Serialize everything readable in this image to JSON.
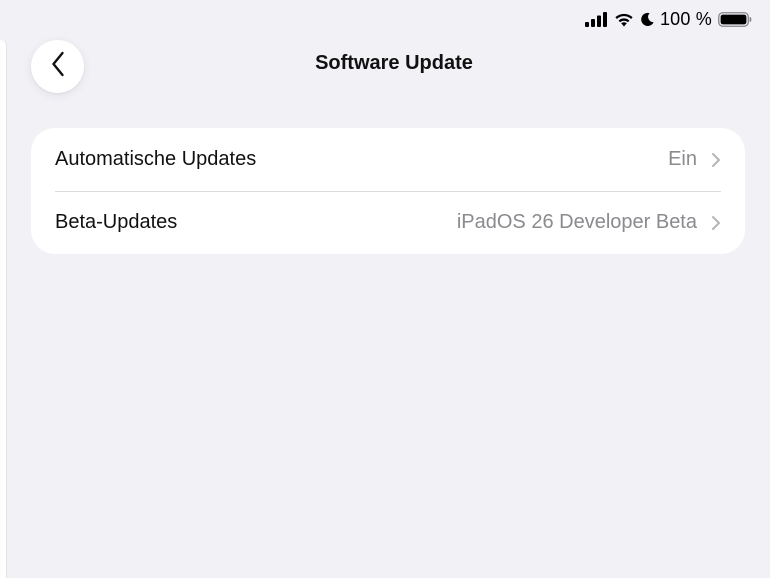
{
  "status_bar": {
    "battery_percent": "100 %",
    "icons": [
      "cellular-signal-icon",
      "wifi-icon",
      "moon-icon",
      "battery-icon"
    ]
  },
  "navigation": {
    "back_icon": "chevron-left-icon",
    "title": "Software Update"
  },
  "settings": {
    "rows": [
      {
        "label": "Automatische Updates",
        "value": "Ein",
        "icon": "chevron-right-icon"
      },
      {
        "label": "Beta-Updates",
        "value": "iPadOS 26 Developer Beta",
        "icon": "chevron-right-icon"
      }
    ]
  },
  "colors": {
    "background": "#f2f1f6",
    "card": "#ffffff",
    "secondary_text": "#8a8a8f",
    "separator": "#dcdbe0"
  }
}
